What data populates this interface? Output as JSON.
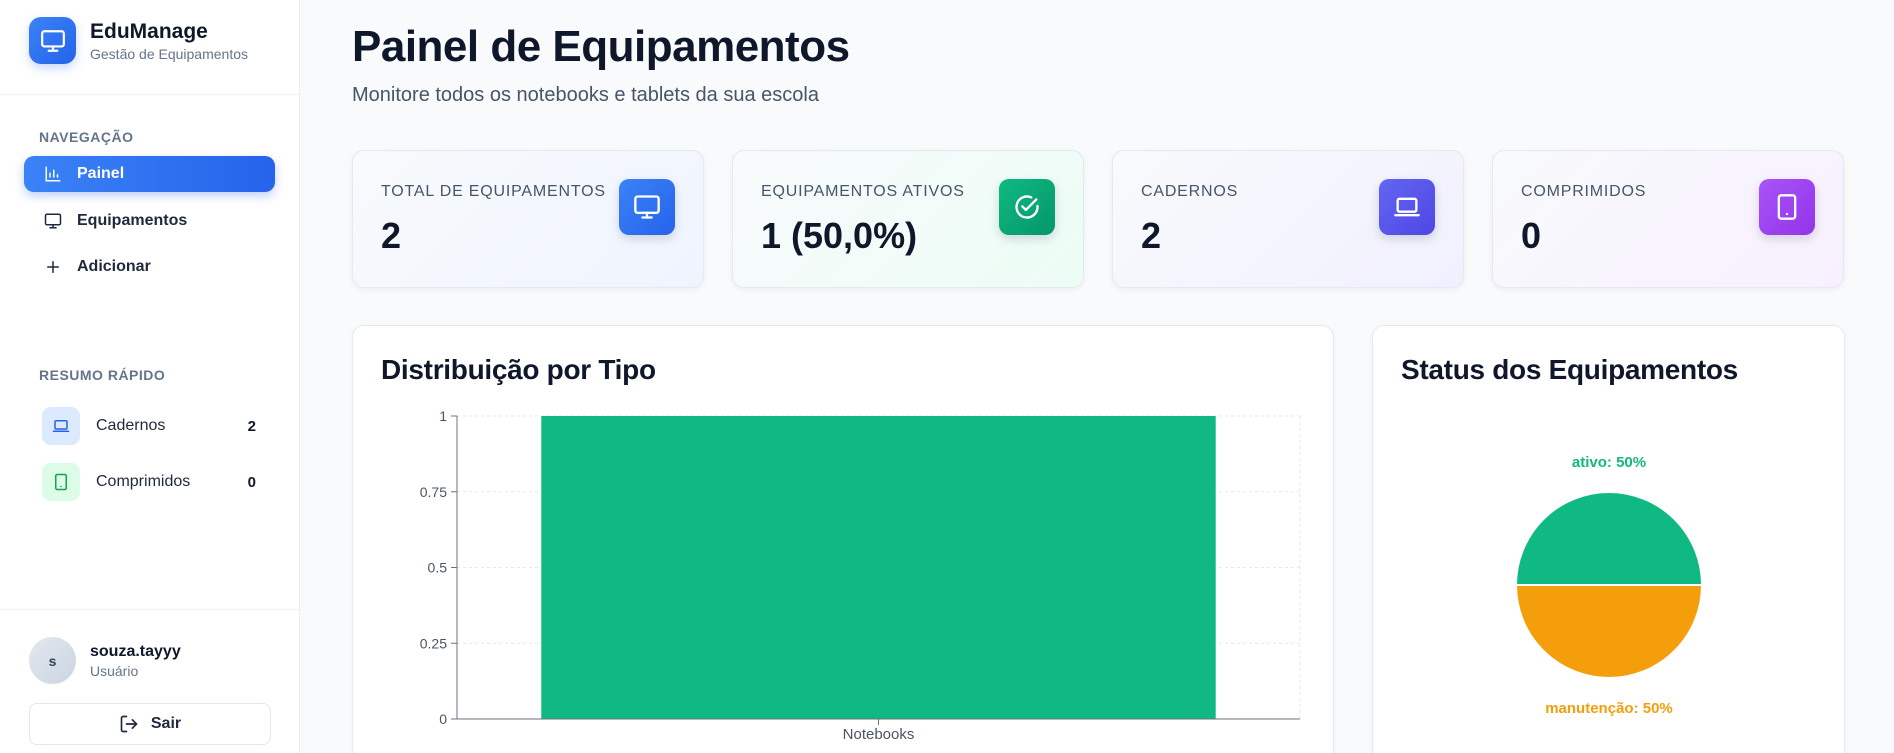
{
  "brand": {
    "title": "EduManage",
    "subtitle": "Gestão de Equipamentos",
    "icon": "monitor-icon",
    "color": "#2563eb"
  },
  "sidebar": {
    "nav_label": "NAVEGAÇÃO",
    "items": [
      {
        "label": "Painel",
        "icon": "bar-chart-icon",
        "active": true
      },
      {
        "label": "Equipamentos",
        "icon": "monitor-icon",
        "active": false
      },
      {
        "label": "Adicionar",
        "icon": "plus-icon",
        "active": false
      }
    ],
    "summary_label": "RESUMO RÁPIDO",
    "summary": [
      {
        "label": "Cadernos",
        "count": "2",
        "icon": "laptop-icon",
        "color": "#2563eb"
      },
      {
        "label": "Comprimidos",
        "count": "0",
        "icon": "tablet-icon",
        "color": "#16a34a"
      }
    ]
  },
  "user": {
    "initial": "s",
    "name": "souza.tayyy",
    "role": "Usuário",
    "logout_label": "Sair"
  },
  "header": {
    "title": "Painel de Equipamentos",
    "subtitle": "Monitore todos os notebooks e tablets da sua escola"
  },
  "stats": [
    {
      "label": "TOTAL DE EQUIPAMENTOS",
      "value": "2",
      "icon": "monitor-icon",
      "color": "#2563eb"
    },
    {
      "label": "EQUIPAMENTOS ATIVOS",
      "value": "1 (50,0%)",
      "icon": "check-circle-icon",
      "color": "#059669"
    },
    {
      "label": "CADERNOS",
      "value": "2",
      "icon": "laptop-icon",
      "color": "#4f46e5"
    },
    {
      "label": "COMPRIMIDOS",
      "value": "0",
      "icon": "tablet-icon",
      "color": "#9333ea"
    }
  ],
  "charts": {
    "type_title": "Distribuição por Tipo",
    "status_title": "Status dos Equipamentos"
  },
  "chart_data": [
    {
      "type": "bar",
      "title": "Distribuição por Tipo",
      "categories": [
        "Notebooks"
      ],
      "values": [
        1
      ],
      "ylim": [
        0,
        1
      ],
      "yticks": [
        "0",
        "0.25",
        "0.5",
        "0.75",
        "1"
      ],
      "grid": true,
      "color": "#10b981"
    },
    {
      "type": "pie",
      "title": "Status dos Equipamentos",
      "labels": [
        "ativo",
        "manutenção"
      ],
      "values": [
        50,
        50
      ],
      "slice_labels": [
        "ativo: 50%",
        "manutenção: 50%"
      ],
      "colors": [
        "#10b981",
        "#f59e0b"
      ]
    }
  ]
}
